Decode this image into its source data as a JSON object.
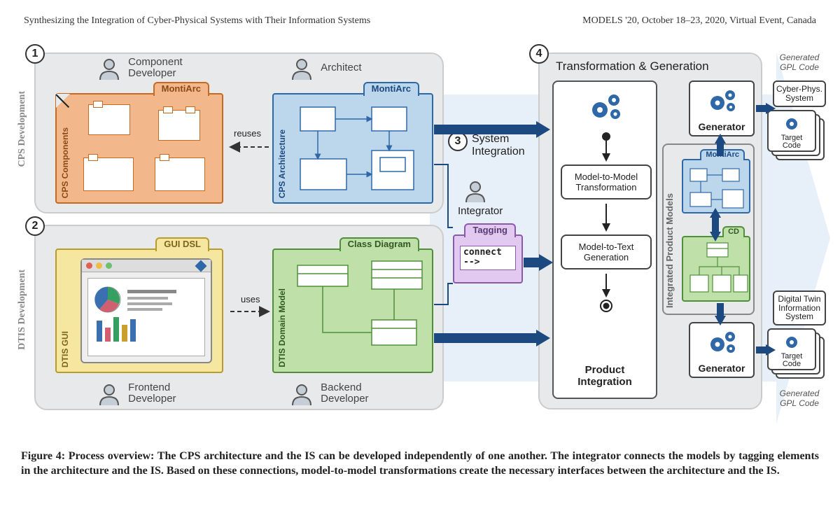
{
  "header": {
    "left": "Synthesizing the Integration of Cyber-Physical Systems with Their Information Systems",
    "right": "MODELS '20, October 18–23, 2020, Virtual Event, Canada"
  },
  "numbers": {
    "n1": "1",
    "n2": "2",
    "n3": "3",
    "n4": "4"
  },
  "vlabels": {
    "cps": "CPS Development",
    "dtis": "DTIS Development",
    "ipm": "Integrated Product Models"
  },
  "roles": {
    "component_dev": "Component\nDeveloper",
    "architect": "Architect",
    "frontend_dev": "Frontend\nDeveloper",
    "backend_dev": "Backend\nDeveloper",
    "integrator": "Integrator"
  },
  "cards": {
    "cps_comp": {
      "tab": "MontiArc",
      "side": "CPS Components"
    },
    "cps_arch": {
      "tab": "MontiArc",
      "side": "CPS Architecture"
    },
    "gui": {
      "tab": "GUI DSL",
      "side": "DTIS GUI"
    },
    "domain": {
      "tab": "Class Diagram",
      "side": "DTIS Domain Model"
    },
    "mini_ma": {
      "tab": "MontiArc"
    },
    "mini_cd": {
      "tab": "CD"
    }
  },
  "rel": {
    "reuses": "reuses",
    "uses": "uses"
  },
  "sysint": {
    "title": "System\nIntegration",
    "tag_tab": "Tagging",
    "code": "connect\n-->"
  },
  "panel4": {
    "title": "Transformation & Generation",
    "m2m": "Model-to-Model\nTransformation",
    "m2t": "Model-to-Text\nGeneration",
    "prod": "Product\nIntegration",
    "gen": "Generator"
  },
  "outputs": {
    "gen_top": "Generated\nGPL Code",
    "cps_sys": "Cyber-Phys.\nSystem",
    "target": "Target\nCode",
    "dtis_sys": "Digital Twin\nInformation\nSystem",
    "gen_bot": "Generated\nGPL Code"
  },
  "caption": "Figure 4: Process overview: The CPS architecture and the IS can be developed independently of one another. The integrator connects the models by tagging elements in the architecture and the IS. Based on these connections, model-to-model transformations create the necessary interfaces between the architecture and the IS."
}
